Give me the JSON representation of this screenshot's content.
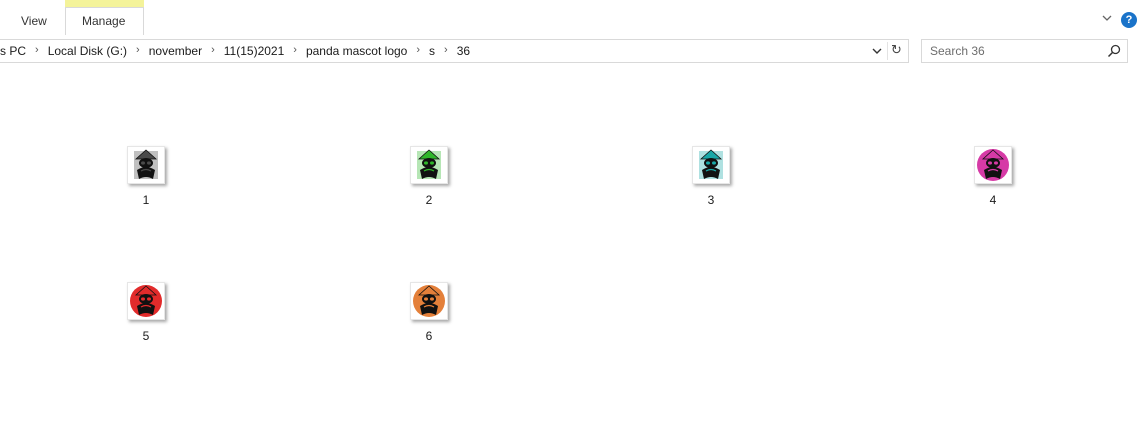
{
  "window": {
    "title_fragment": "36"
  },
  "ribbon": {
    "tabs": [
      {
        "label": "View"
      },
      {
        "label": "Manage",
        "highlight": "#f4f39a"
      }
    ],
    "help_symbol": "?"
  },
  "address": {
    "crumbs": [
      "s PC",
      "Local Disk (G:)",
      "november",
      "11(15)2021",
      "panda mascot logo",
      "s",
      "36"
    ],
    "separator": "›",
    "refresh_symbol": "↻"
  },
  "search": {
    "placeholder": "Search 36"
  },
  "files": [
    {
      "name": "1",
      "color": "#4a4a4a",
      "shape": "square"
    },
    {
      "name": "2",
      "color": "#2fb62a",
      "shape": "square"
    },
    {
      "name": "3",
      "color": "#1aa8a8",
      "shape": "square"
    },
    {
      "name": "4",
      "color": "#d63aa6",
      "shape": "round"
    },
    {
      "name": "5",
      "color": "#e22b2b",
      "shape": "round"
    },
    {
      "name": "6",
      "color": "#e4803a",
      "shape": "round"
    }
  ]
}
